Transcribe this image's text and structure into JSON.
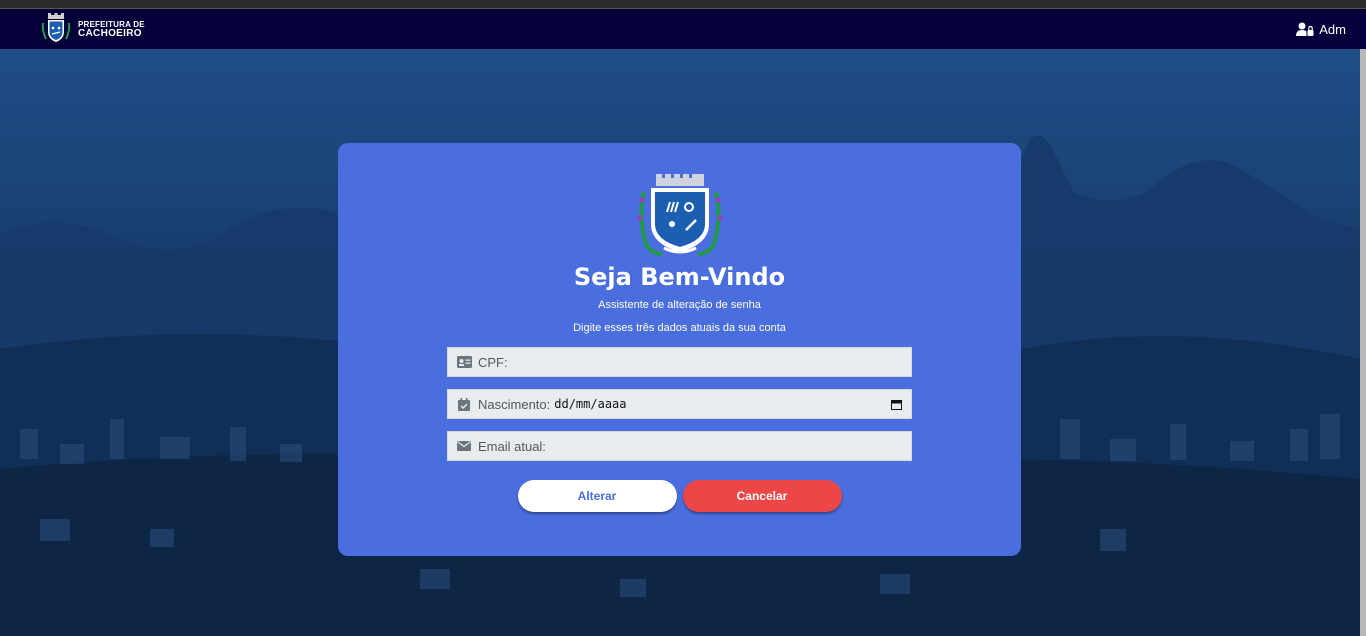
{
  "header": {
    "brand_line1": "PREFEITURA DE",
    "brand_line2": "CACHOEIRO",
    "user_label": "Adm",
    "user_icon": "user-lock-icon"
  },
  "card": {
    "title": "Seja Bem-Vindo",
    "subtitle": "Assistente de alteração de senha",
    "instruction": "Digite esses três dados atuais da sua conta",
    "crest_icon": "city-coat-of-arms"
  },
  "form": {
    "cpf": {
      "label": "CPF:",
      "value": "",
      "icon": "id-card-icon"
    },
    "nascimento": {
      "label": "Nascimento:",
      "value": "dd/mm/aaaa",
      "icon": "calendar-check-icon"
    },
    "email": {
      "label": "Email atual:",
      "value": "",
      "icon": "envelope-icon"
    }
  },
  "buttons": {
    "alterar": "Alterar",
    "cancelar": "Cancelar"
  },
  "colors": {
    "navbar": "#04003a",
    "card": "#4a6ede",
    "cancel": "#ec4646",
    "field": "#e9ecef"
  }
}
